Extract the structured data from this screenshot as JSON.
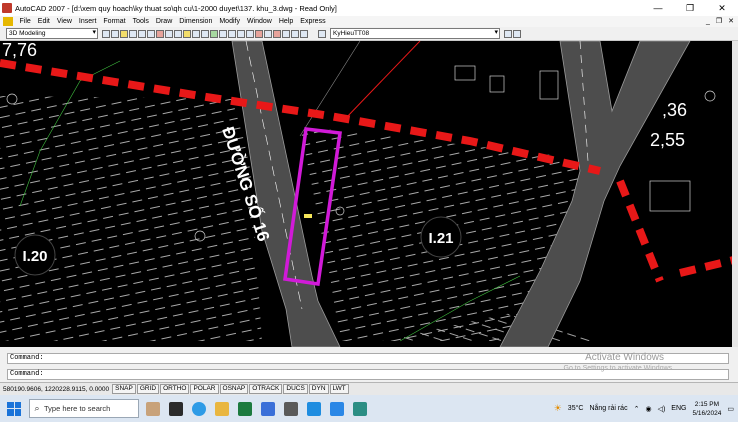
{
  "titlebar": {
    "title": "AutoCAD 2007 - [d:\\xem quy hoach\\ky thuat so\\qh cu\\1-2000 duyet\\137. khu_3.dwg - Read Only]",
    "minimize": "—",
    "maximize": "❐",
    "close": "✕"
  },
  "menubar": {
    "items": [
      "File",
      "Edit",
      "View",
      "Insert",
      "Format",
      "Tools",
      "Draw",
      "Dimension",
      "Modify",
      "Window",
      "Help",
      "Express"
    ],
    "doc_minimize": "_",
    "doc_restore": "❐",
    "doc_close": "✕"
  },
  "toolbar": {
    "workspace": "3D Modeling",
    "layer": "KyHieuTT08"
  },
  "drawing": {
    "labels": {
      "top_left_number": "7,76",
      "right_number_top": ",36",
      "right_number_bottom": "2,55",
      "street_name": "ĐƯỜNG SỐ 16",
      "lot_left": "I.20",
      "lot_center": "I.21"
    },
    "colors": {
      "background": "#000000",
      "boundary_dashes": "#e81818",
      "selection_rect": "#d11ad8",
      "road": "#555555",
      "hatch": "#bdbdbd"
    }
  },
  "command": {
    "line1": "Command:",
    "line2": "Command:",
    "watermark": "Activate Windows",
    "watermark_sub": "Go to Settings to activate Windows."
  },
  "status": {
    "coordinates": "580190.9606, 1220228.9115, 0.0000",
    "toggles": [
      "SNAP",
      "GRID",
      "ORTHO",
      "POLAR",
      "OSNAP",
      "OTRACK",
      "DUCS",
      "DYN",
      "LWT"
    ]
  },
  "taskbar": {
    "search_placeholder": "Type here to search",
    "weather_temp": "35°C",
    "weather_text": "Nắng rải rác",
    "lang": "ENG",
    "time": "2:15 PM",
    "date": "5/16/2024"
  }
}
